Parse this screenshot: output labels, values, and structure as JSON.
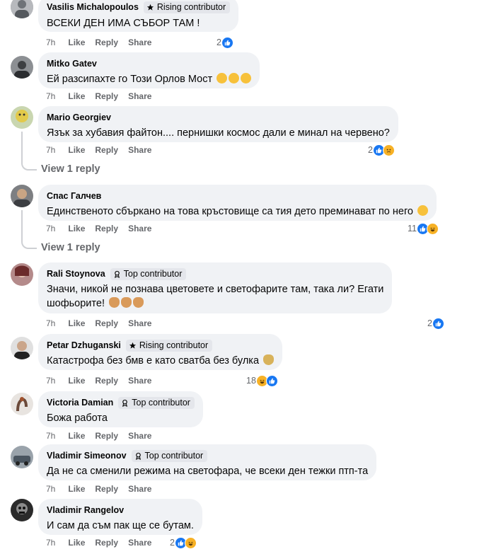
{
  "labels": {
    "like": "Like",
    "reply": "Reply",
    "share": "Share"
  },
  "colors": {
    "bubble": "#f0f2f5",
    "like_blue": "#1877f2",
    "meta_gray": "#65676b"
  },
  "comments": [
    {
      "author": "Vasilis Michalopoulos",
      "badge": "Rising contributor",
      "badge_icon": "star-icon",
      "text": "ВСЕКИ ДЕН ИМА СЪБОР ТАМ !",
      "time": "7h",
      "reaction_count": "2",
      "reactions": [
        "like"
      ]
    },
    {
      "author": "Mitko Gatev",
      "badge": "",
      "text": "Ей разсипахте го Този Орлов Мост",
      "text_emojis": [
        "thinking-emoji",
        "sad-emoji",
        "crying-emoji"
      ],
      "time": "7h",
      "reaction_count": "",
      "reactions": []
    },
    {
      "author": "Mario Georgiev",
      "badge": "",
      "text": "Язък за хубавия файтон.... пернишки космос дали е минал на червено?",
      "time": "7h",
      "reaction_count": "2",
      "reactions": [
        "like",
        "sad"
      ],
      "view_replies": "View 1 reply"
    },
    {
      "author": "Спас Галчев",
      "badge": "",
      "text": "Единственото сбъркано на това кръстовище са тия дето преминават по него",
      "text_emojis": [
        "grin-emoji"
      ],
      "time": "7h",
      "reaction_count": "11",
      "reactions": [
        "like",
        "haha"
      ],
      "view_replies": "View 1 reply"
    },
    {
      "author": "Rali Stoynova",
      "badge": "Top contributor",
      "badge_icon": "award-icon",
      "text_line1": "Значи, никой не познава цветовете и светофарите там, така ли? Егати",
      "text_line2": "шофьорите!",
      "text_emojis": [
        "facepalm-emoji",
        "facepalm-emoji",
        "facepalm-emoji"
      ],
      "time": "7h",
      "reaction_count": "2",
      "reactions": [
        "like"
      ]
    },
    {
      "author": "Petar Dzhuganski",
      "badge": "Rising contributor",
      "badge_icon": "star-icon",
      "text": "Катастрофа без бмв е като сватба без булка",
      "text_emojis": [
        "shrug-emoji"
      ],
      "time": "7h",
      "reaction_count": "18",
      "reactions": [
        "haha",
        "like"
      ]
    },
    {
      "author": "Victoria Damian",
      "badge": "Top contributor",
      "badge_icon": "award-icon",
      "text": "Божа работа",
      "time": "7h",
      "reaction_count": "",
      "reactions": []
    },
    {
      "author": "Vladimir Simeonov",
      "badge": "Top contributor",
      "badge_icon": "award-icon",
      "text": "Да не са сменили режима на светофара, че всеки ден тежки птп-та",
      "time": "7h",
      "reaction_count": "",
      "reactions": []
    },
    {
      "author": "Vladimir Rangelov",
      "badge": "",
      "text": "И сам да съм пак ще се бутам.",
      "time": "7h",
      "reaction_count": "2",
      "reactions": [
        "like",
        "haha"
      ]
    }
  ]
}
